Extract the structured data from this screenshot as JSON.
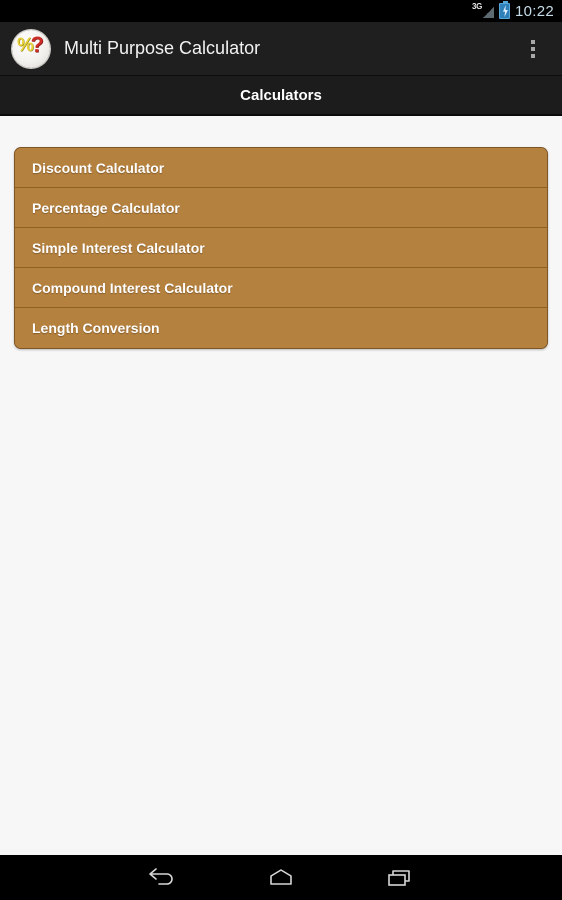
{
  "status_bar": {
    "network_label": "3G",
    "network_icon": "signal-3g-icon",
    "battery_icon": "battery-charging-icon",
    "time": "10:22"
  },
  "action_bar": {
    "app_icon": "percent-question-app-icon",
    "title": "Multi Purpose Calculator",
    "overflow_icon": "overflow-menu-icon"
  },
  "section_header": {
    "title": "Calculators"
  },
  "calculator_list": {
    "items": [
      {
        "label": "Discount Calculator"
      },
      {
        "label": "Percentage Calculator"
      },
      {
        "label": "Simple Interest Calculator"
      },
      {
        "label": "Compound Interest Calculator"
      },
      {
        "label": "Length Conversion"
      }
    ]
  },
  "navigation_bar": {
    "back_icon": "back-arrow-icon",
    "home_icon": "home-icon",
    "recents_icon": "recent-apps-icon"
  },
  "colors": {
    "status_bar_bg": "#000000",
    "action_bar_bg": "#1f1f1f",
    "section_header_bg": "#1c1c1c",
    "content_bg": "#f7f7f7",
    "list_item_bg": "#b5813f",
    "list_border": "#7d5526",
    "list_divider": "#8d6026",
    "text_on_list": "#ffffff",
    "clock_text": "#c6dbe8",
    "battery_accent": "#2f7fb8"
  }
}
